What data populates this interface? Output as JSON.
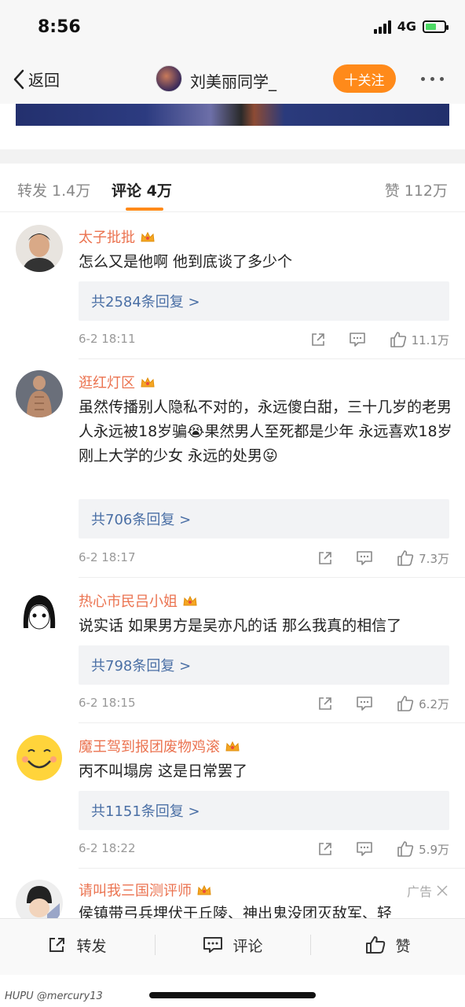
{
  "status": {
    "time": "8:56",
    "network": "4G"
  },
  "nav": {
    "back_label": "返回",
    "title": "刘美丽同学_",
    "follow_label": "十关注"
  },
  "tabs": {
    "repost": "转发 1.4万",
    "comment": "评论 4万",
    "like": "赞 112万"
  },
  "comments": [
    {
      "name": "太子批批",
      "text": "怎么又是他啊 他到底谈了多少个",
      "replies": "共2584条回复 >",
      "time": "6-2 18:11",
      "likes": "11.1万"
    },
    {
      "name": "逛红灯区",
      "text": "虽然传播别人隐私不对的，永远傻白甜，三十几岁的老男人永远被18岁骗😭果然男人至死都是少年 永远喜欢18岁刚上大学的少女 永远的处男😝",
      "replies": "共706条回复 >",
      "time": "6-2 18:17",
      "likes": "7.3万"
    },
    {
      "name": "热心市民吕小姐",
      "text": "说实话 如果男方是吴亦凡的话 那么我真的相信了",
      "replies": "共798条回复 >",
      "time": "6-2 18:15",
      "likes": "6.2万"
    },
    {
      "name": "魔王驾到报团废物鸡滚",
      "text": "丙不叫塌房 这是日常罢了",
      "replies": "共1151条回复 >",
      "time": "6-2 18:22",
      "likes": "5.9万"
    },
    {
      "name": "请叫我三国测评师",
      "text": "侯镇带弓兵埋伏于丘陵、神出鬼没团灭敌军、轻",
      "ad_label": "广告"
    }
  ],
  "bottom": {
    "repost": "转发",
    "comment": "评论",
    "like": "赞"
  },
  "watermark": "HUPU @mercury13",
  "colors": {
    "accent": "#ff8a1a",
    "username": "#eb7350",
    "reply_link": "#4a6fa5"
  }
}
